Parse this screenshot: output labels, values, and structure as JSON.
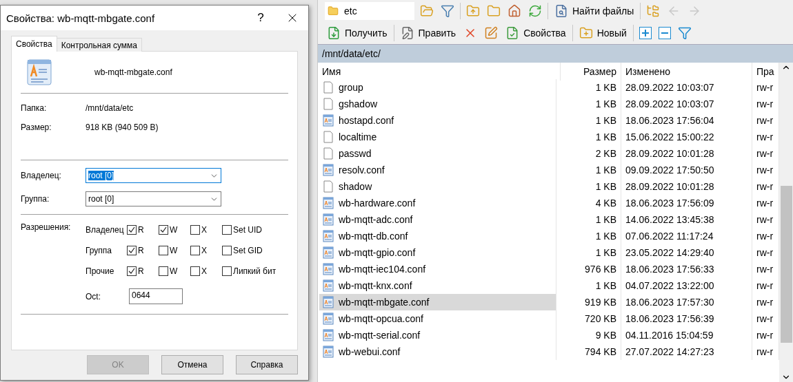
{
  "dialog": {
    "title": "Свойства: wb-mqtt-mbgate.conf",
    "help": "?",
    "tabs": [
      {
        "label": "Свойства",
        "selected": true
      },
      {
        "label": "Контрольная сумма",
        "selected": false
      }
    ],
    "file_name": "wb-mqtt-mbgate.conf",
    "info": [
      {
        "label": "Папка:",
        "value": "/mnt/data/etc"
      },
      {
        "label": "Размер:",
        "value": "918 KB (940 509 B)"
      }
    ],
    "owner": {
      "label": "Владелец:",
      "value": "root [0]",
      "focused": true
    },
    "group": {
      "label": "Группа:",
      "value": "root [0]",
      "focused": false
    },
    "permissions": {
      "label": "Разрешения:",
      "rows": [
        {
          "label": "Владелец",
          "flags": [
            {
              "label": "R",
              "checked": true
            },
            {
              "label": "W",
              "checked": true
            },
            {
              "label": "X",
              "checked": false
            },
            {
              "label": "Set UID",
              "checked": false
            }
          ]
        },
        {
          "label": "Группа",
          "flags": [
            {
              "label": "R",
              "checked": true
            },
            {
              "label": "W",
              "checked": false
            },
            {
              "label": "X",
              "checked": false
            },
            {
              "label": "Set GID",
              "checked": false
            }
          ]
        },
        {
          "label": "Прочие",
          "flags": [
            {
              "label": "R",
              "checked": true
            },
            {
              "label": "W",
              "checked": false
            },
            {
              "label": "X",
              "checked": false
            },
            {
              "label": "Липкий бит",
              "checked": false
            }
          ]
        }
      ],
      "octal_label": "Oct:",
      "octal_value": "0644"
    },
    "buttons": [
      {
        "label": "OK",
        "disabled": true
      },
      {
        "label": "Отмена",
        "disabled": false
      },
      {
        "label": "Справка",
        "disabled": false
      }
    ]
  },
  "explorer": {
    "location": "etc",
    "find": "Найти файлы",
    "actions": [
      "Получить",
      "Править",
      "Свойства",
      "Новый"
    ],
    "path": "/mnt/data/etc/",
    "columns": [
      "Имя",
      "Размер",
      "Изменено",
      "Пра"
    ],
    "rows": [
      {
        "kind": "plain",
        "name": "group",
        "size": "1 KB",
        "modified": "28.09.2022 10:03:07",
        "perm": "rw-r",
        "selected": false
      },
      {
        "kind": "plain",
        "name": "gshadow",
        "size": "1 KB",
        "modified": "28.09.2022 10:03:07",
        "perm": "rw-r",
        "selected": false
      },
      {
        "kind": "text",
        "name": "hostapd.conf",
        "size": "1 KB",
        "modified": "18.06.2023 17:56:04",
        "perm": "rw-r",
        "selected": false
      },
      {
        "kind": "plain",
        "name": "localtime",
        "size": "1 KB",
        "modified": "15.06.2022 15:00:22",
        "perm": "rw-r",
        "selected": false
      },
      {
        "kind": "plain",
        "name": "passwd",
        "size": "2 KB",
        "modified": "28.09.2022 10:01:28",
        "perm": "rw-r",
        "selected": false
      },
      {
        "kind": "text",
        "name": "resolv.conf",
        "size": "1 KB",
        "modified": "09.09.2022 17:50:50",
        "perm": "rw-r",
        "selected": false
      },
      {
        "kind": "plain",
        "name": "shadow",
        "size": "1 KB",
        "modified": "28.09.2022 10:01:28",
        "perm": "rw-r",
        "selected": false
      },
      {
        "kind": "text",
        "name": "wb-hardware.conf",
        "size": "4 KB",
        "modified": "18.06.2023 17:56:09",
        "perm": "rw-r",
        "selected": false
      },
      {
        "kind": "text",
        "name": "wb-mqtt-adc.conf",
        "size": "1 KB",
        "modified": "14.06.2022 13:45:38",
        "perm": "rw-r",
        "selected": false
      },
      {
        "kind": "text",
        "name": "wb-mqtt-db.conf",
        "size": "1 KB",
        "modified": "07.06.2022 11:17:24",
        "perm": "rw-r",
        "selected": false
      },
      {
        "kind": "text",
        "name": "wb-mqtt-gpio.conf",
        "size": "1 KB",
        "modified": "23.05.2022 14:29:40",
        "perm": "rw-r",
        "selected": false
      },
      {
        "kind": "text",
        "name": "wb-mqtt-iec104.conf",
        "size": "976 KB",
        "modified": "18.06.2023 17:56:33",
        "perm": "rw-r",
        "selected": false
      },
      {
        "kind": "text",
        "name": "wb-mqtt-knx.conf",
        "size": "1 KB",
        "modified": "04.07.2022 13:22:00",
        "perm": "rw-r",
        "selected": false
      },
      {
        "kind": "text",
        "name": "wb-mqtt-mbgate.conf",
        "size": "919 KB",
        "modified": "18.06.2023 17:57:30",
        "perm": "rw-r",
        "selected": true
      },
      {
        "kind": "text",
        "name": "wb-mqtt-opcua.conf",
        "size": "720 KB",
        "modified": "18.06.2023 17:56:39",
        "perm": "rw-r",
        "selected": false
      },
      {
        "kind": "text",
        "name": "wb-mqtt-serial.conf",
        "size": "9 KB",
        "modified": "04.11.2016 15:04:59",
        "perm": "rw-r",
        "selected": false
      },
      {
        "kind": "text",
        "name": "wb-webui.conf",
        "size": "794 KB",
        "modified": "27.07.2022 14:27:23",
        "perm": "rw-r",
        "selected": false
      }
    ]
  }
}
